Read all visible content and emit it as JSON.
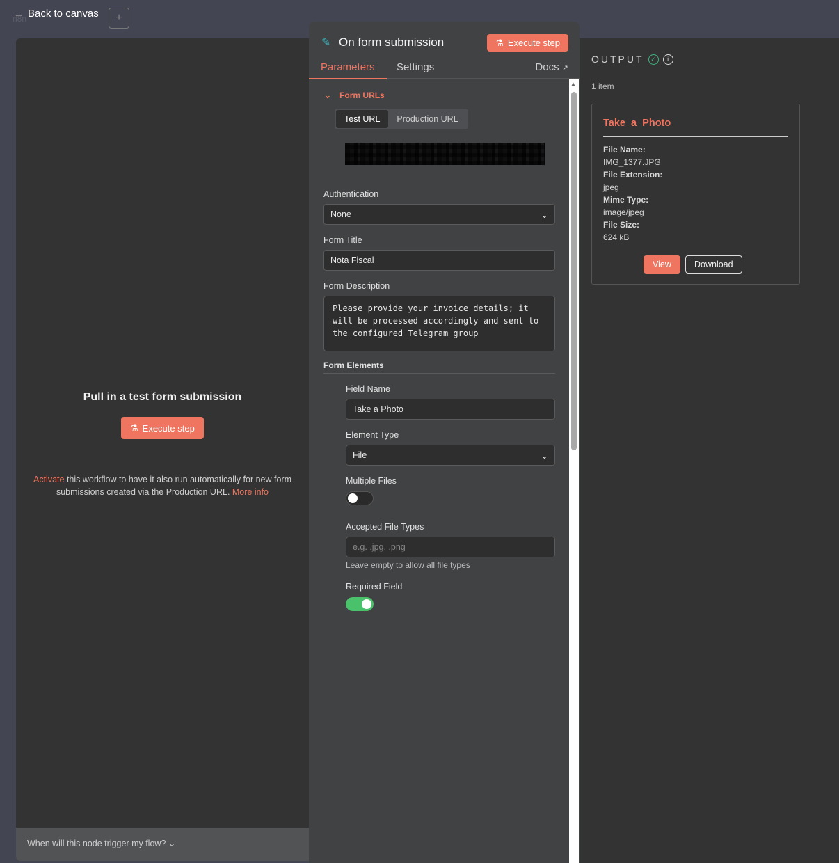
{
  "topbar": {
    "logo": "n8n",
    "back_label": "Back to canvas",
    "add_label": "+"
  },
  "left": {
    "title": "Pull in a test form submission",
    "execute_label": "Execute step",
    "note_activate": "Activate",
    "note_text": " this workflow to have it also run automatically for new form submissions created via the Production URL.  ",
    "note_more": "More info",
    "bottom_label": "When will this node trigger my flow?"
  },
  "node": {
    "title": "On form submission",
    "execute_label": "Execute step",
    "tabs": [
      "Parameters",
      "Settings"
    ],
    "docs_label": "Docs",
    "form_urls_label": "Form URLs",
    "url_tabs": [
      "Test URL",
      "Production URL"
    ],
    "auth_label": "Authentication",
    "auth_value": "None",
    "form_title_label": "Form Title",
    "form_title_value": "Nota Fiscal",
    "form_desc_label": "Form Description",
    "form_desc_value": "Please provide your invoice details; it will be processed accordingly and sent to the configured Telegram group",
    "form_elements_label": "Form Elements",
    "field_name_label": "Field Name",
    "field_name_value": "Take a Photo",
    "element_type_label": "Element Type",
    "element_type_value": "File",
    "multiple_files_label": "Multiple Files",
    "multiple_files": false,
    "accepted_label": "Accepted File Types",
    "accepted_placeholder": "e.g. .jpg, .png",
    "accepted_hint": "Leave empty to allow all file types",
    "required_label": "Required Field",
    "required": true
  },
  "output": {
    "title": "OUTPUT",
    "count": "1 item",
    "card_title": "Take_a_Photo",
    "fields": [
      {
        "k": "File Name:",
        "v": "IMG_1377.JPG"
      },
      {
        "k": "File Extension:",
        "v": "jpeg"
      },
      {
        "k": "Mime Type:",
        "v": "image/jpeg"
      },
      {
        "k": "File Size:",
        "v": "624 kB"
      }
    ],
    "view_label": "View",
    "download_label": "Download"
  },
  "colors": {
    "accent": "#ef7560",
    "success": "#3fb27f",
    "toggle_on": "#4ac26b"
  }
}
